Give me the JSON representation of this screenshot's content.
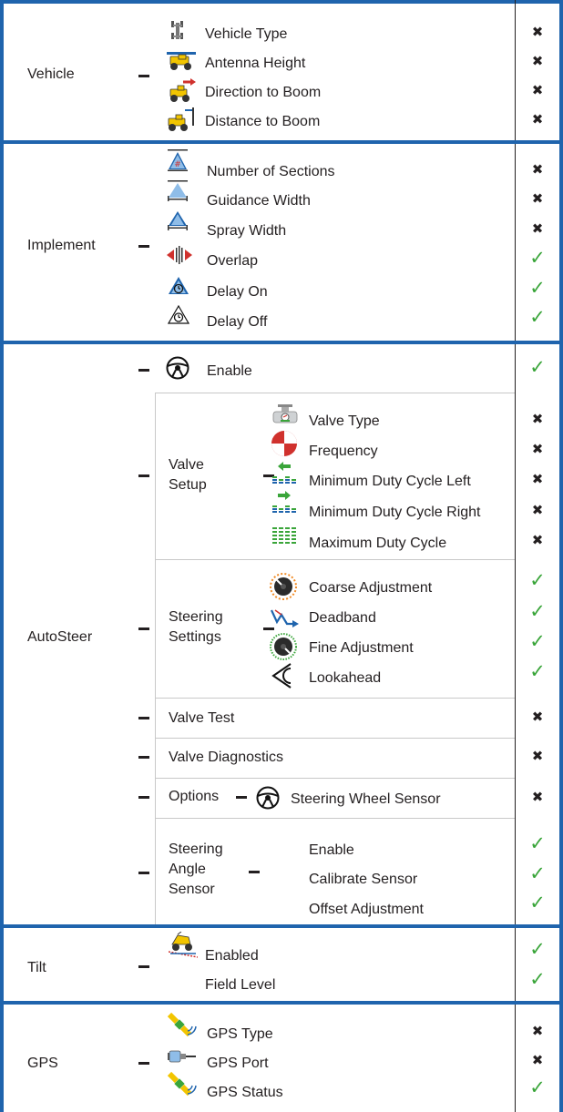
{
  "status_icons": {
    "supported": "check-mark",
    "not_supported": "x-mark",
    "check_color": "#3aa53a"
  },
  "vehicle": {
    "category": "Vehicle",
    "items": [
      {
        "label": "Vehicle Type",
        "icon": "vehicle-type-icon",
        "status": "not_supported"
      },
      {
        "label": "Antenna Height",
        "icon": "antenna-height-icon",
        "status": "not_supported"
      },
      {
        "label": "Direction to Boom",
        "icon": "direction-to-boom-icon",
        "status": "not_supported"
      },
      {
        "label": "Distance to Boom",
        "icon": "distance-to-boom-icon",
        "status": "not_supported"
      }
    ]
  },
  "implement": {
    "category": "Implement",
    "items": [
      {
        "label": "Number of Sections",
        "icon": "number-of-sections-icon",
        "status": "not_supported"
      },
      {
        "label": "Guidance Width",
        "icon": "guidance-width-icon",
        "status": "not_supported"
      },
      {
        "label": "Spray Width",
        "icon": "spray-width-icon",
        "status": "not_supported"
      },
      {
        "label": "Overlap",
        "icon": "overlap-icon",
        "status": "supported"
      },
      {
        "label": "Delay On",
        "icon": "delay-on-icon",
        "status": "supported"
      },
      {
        "label": "Delay Off",
        "icon": "delay-off-icon",
        "status": "supported"
      }
    ]
  },
  "autosteer": {
    "category": "AutoSteer",
    "enable": {
      "label": "Enable",
      "icon": "steering-wheel-icon",
      "status": "supported"
    },
    "valve_setup": {
      "title_line1": "Valve",
      "title_line2": "Setup",
      "items": [
        {
          "label": "Valve Type",
          "icon": "valve-type-icon",
          "status": "not_supported"
        },
        {
          "label": "Frequency",
          "icon": "frequency-icon",
          "status": "not_supported"
        },
        {
          "label": "Minimum Duty Cycle Left",
          "icon": "min-duty-left-icon",
          "status": "not_supported"
        },
        {
          "label": "Minimum Duty Cycle Right",
          "icon": "min-duty-right-icon",
          "status": "not_supported"
        },
        {
          "label": "Maximum Duty Cycle",
          "icon": "max-duty-icon",
          "status": "not_supported"
        }
      ]
    },
    "steering_settings": {
      "title_line1": "Steering",
      "title_line2": "Settings",
      "items": [
        {
          "label": "Coarse Adjustment",
          "icon": "coarse-adjustment-icon",
          "status": "supported"
        },
        {
          "label": "Deadband",
          "icon": "deadband-icon",
          "status": "supported"
        },
        {
          "label": "Fine Adjustment",
          "icon": "fine-adjustment-icon",
          "status": "supported"
        },
        {
          "label": "Lookahead",
          "icon": "lookahead-icon",
          "status": "supported"
        }
      ]
    },
    "valve_test": {
      "label": "Valve Test",
      "status": "not_supported"
    },
    "valve_diagnostics": {
      "label": "Valve Diagnostics",
      "status": "not_supported"
    },
    "options": {
      "title": "Options",
      "item": {
        "label": "Steering Wheel Sensor",
        "icon": "steering-wheel-sensor-icon",
        "status": "not_supported"
      }
    },
    "steering_angle_sensor": {
      "title_line1": "Steering",
      "title_line2": "Angle",
      "title_line3": "Sensor",
      "items": [
        {
          "label": "Enable",
          "status": "supported"
        },
        {
          "label": "Calibrate Sensor",
          "status": "supported"
        },
        {
          "label": "Offset Adjustment",
          "status": "supported"
        }
      ]
    }
  },
  "tilt": {
    "category": "Tilt",
    "items": [
      {
        "label": "Enabled",
        "icon": "tilt-icon",
        "status": "supported"
      },
      {
        "label": "Field Level",
        "status": "supported"
      }
    ]
  },
  "gps": {
    "category": "GPS",
    "items": [
      {
        "label": "GPS Type",
        "icon": "gps-satellite-icon",
        "status": "not_supported"
      },
      {
        "label": "GPS Port",
        "icon": "gps-port-icon",
        "status": "not_supported"
      },
      {
        "label": "GPS Status",
        "icon": "gps-satellite-icon",
        "status": "supported"
      }
    ]
  }
}
